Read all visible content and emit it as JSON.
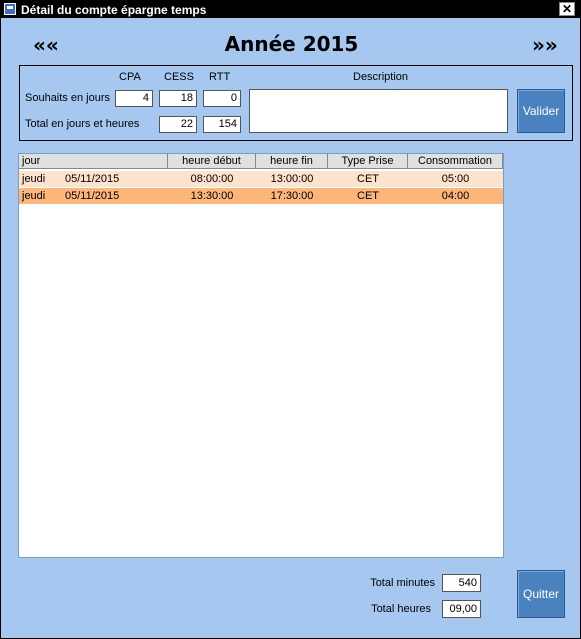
{
  "window": {
    "title": "Détail du compte épargne temps",
    "close_glyph": "✕"
  },
  "nav": {
    "prev": "««",
    "next": "»»"
  },
  "year_label": "Année 2015",
  "form": {
    "col_cpa": "CPA",
    "col_cess": "CESS",
    "col_rtt": "RTT",
    "col_description": "Description",
    "row1_label": "Souhaits en jours",
    "row2_label": "Total en jours et  heures",
    "souhaits_cpa": "4",
    "souhaits_cess": "18",
    "souhaits_rtt": "0",
    "total_cess": "22",
    "total_rtt": "154",
    "description": "",
    "valider": "Valider"
  },
  "table": {
    "headers": [
      "jour",
      "heure début",
      "heure fin",
      "Type Prise",
      "Consommation"
    ],
    "rows": [
      {
        "jour": "jeudi",
        "date": "05/11/2015",
        "debut": "08:00:00",
        "fin": "13:00:00",
        "type": "CET",
        "conso": "05:00",
        "bg": "#fde3cc"
      },
      {
        "jour": "jeudi",
        "date": "05/11/2015",
        "debut": "13:30:00",
        "fin": "17:30:00",
        "type": "CET",
        "conso": "04:00",
        "bg": "#fcb67a"
      }
    ]
  },
  "totals": {
    "minutes_label": "Total minutes",
    "minutes_value": "540",
    "heures_label": "Total heures",
    "heures_value": "09,00"
  },
  "quitter": "Quitter",
  "colors": {
    "window_bg": "#a6c8f0",
    "button": "#4a82c0",
    "row_light": "#fde3cc",
    "row_selected": "#fcb67a"
  }
}
